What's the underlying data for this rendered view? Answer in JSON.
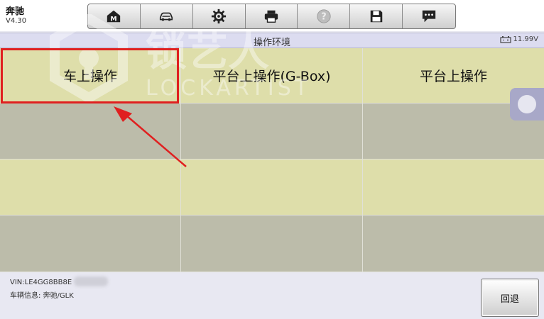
{
  "app": {
    "name": "奔驰",
    "version": "V4.30"
  },
  "toolbar": {
    "buttons": [
      {
        "icon": "home-m-icon"
      },
      {
        "icon": "car-icon"
      },
      {
        "icon": "gear-icon"
      },
      {
        "icon": "printer-icon"
      },
      {
        "icon": "help-icon"
      },
      {
        "icon": "save-icon"
      },
      {
        "icon": "chat-icon"
      }
    ]
  },
  "header": {
    "title": "操作环境",
    "battery": "11.99V"
  },
  "grid": {
    "cells": [
      "车上操作",
      "平台上操作(G-Box)",
      "平台上操作",
      "",
      "",
      "",
      "",
      "",
      "",
      "",
      "",
      ""
    ]
  },
  "watermark": {
    "cn": "锁艺人",
    "en": "LOCKARTIST"
  },
  "footer": {
    "vin": "VIN:LE4GG8BB8E",
    "vehicle_info": "车辆信息: 奔驰/GLK",
    "back_label": "回退"
  },
  "colors": {
    "row_yellow": "#dedeaa",
    "row_gray": "#bcbcaa",
    "highlight": "#e02020"
  }
}
